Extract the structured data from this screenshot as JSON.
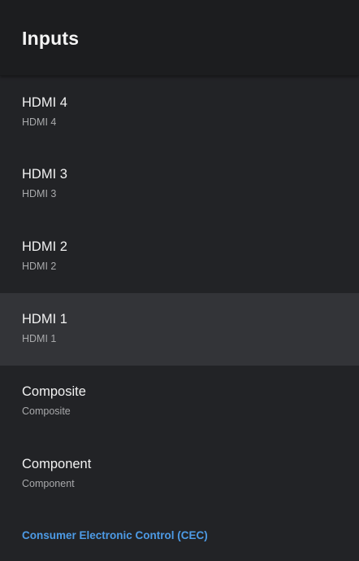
{
  "header": {
    "title": "Inputs"
  },
  "inputs": [
    {
      "title": "HDMI 4",
      "subtitle": "HDMI 4"
    },
    {
      "title": "HDMI 3",
      "subtitle": "HDMI 3"
    },
    {
      "title": "HDMI 2",
      "subtitle": "HDMI 2"
    },
    {
      "title": "HDMI 1",
      "subtitle": "HDMI 1",
      "focused": true
    },
    {
      "title": "Composite",
      "subtitle": "Composite"
    },
    {
      "title": "Component",
      "subtitle": "Component"
    }
  ],
  "cec_link": {
    "label": "Consumer Electronic Control (CEC)"
  },
  "colors": {
    "background": "#222326",
    "header_background": "#1c1d1f",
    "focused_row": "#333438",
    "link": "#4d9be6"
  }
}
